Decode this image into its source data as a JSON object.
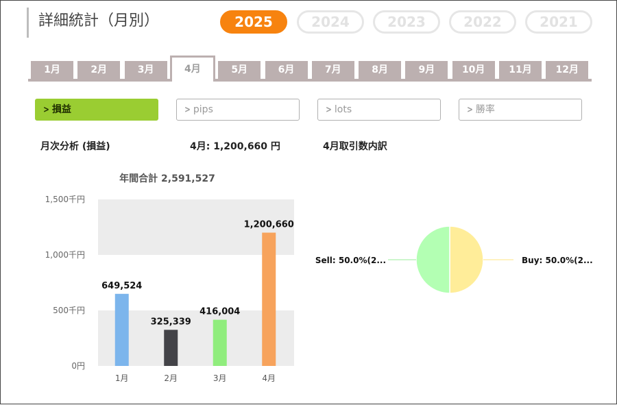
{
  "page_title": "詳細統計（月別）",
  "years": [
    {
      "label": "2025",
      "active": true
    },
    {
      "label": "2024",
      "active": false
    },
    {
      "label": "2023",
      "active": false
    },
    {
      "label": "2022",
      "active": false
    },
    {
      "label": "2021",
      "active": false
    }
  ],
  "months": [
    {
      "label": "1月",
      "active": false
    },
    {
      "label": "2月",
      "active": false
    },
    {
      "label": "3月",
      "active": false
    },
    {
      "label": "4月",
      "active": true
    },
    {
      "label": "5月",
      "active": false
    },
    {
      "label": "6月",
      "active": false
    },
    {
      "label": "7月",
      "active": false
    },
    {
      "label": "8月",
      "active": false
    },
    {
      "label": "9月",
      "active": false
    },
    {
      "label": "10月",
      "active": false
    },
    {
      "label": "11月",
      "active": false
    },
    {
      "label": "12月",
      "active": false
    }
  ],
  "metrics": [
    {
      "label": "損益",
      "active": true
    },
    {
      "label": "pips",
      "active": false
    },
    {
      "label": "lots",
      "active": false
    },
    {
      "label": "勝率",
      "active": false
    }
  ],
  "summary": {
    "monthly_analysis_label": "月次分析 (損益)",
    "selected_month_value": "4月:  1,200,660 円",
    "trade_breakdown_label": "4月取引数内訳"
  },
  "chart_data": [
    {
      "type": "bar",
      "title": "年間合計 2,591,527",
      "categories": [
        "1月",
        "2月",
        "3月",
        "4月"
      ],
      "values": [
        649524,
        325339,
        416004,
        1200660
      ],
      "value_labels": [
        "649,524",
        "325,339",
        "416,004",
        "1,200,660"
      ],
      "colors": [
        "#7cb5ec",
        "#434348",
        "#90ed7d",
        "#f7a35c"
      ],
      "y_ticks": [
        {
          "value": 0,
          "label": "0円"
        },
        {
          "value": 500000,
          "label": "500千円"
        },
        {
          "value": 1000000,
          "label": "1,000千円"
        },
        {
          "value": 1500000,
          "label": "1,500千円"
        }
      ],
      "ylim": [
        0,
        1500000
      ],
      "grid": "alternating bands"
    },
    {
      "type": "pie",
      "slices": [
        {
          "label": "Sell: 50.0%(2...",
          "value": 50.0,
          "color": "#b3ffb3"
        },
        {
          "label": "Buy: 50.0%(2...",
          "value": 50.0,
          "color": "#ffed99"
        }
      ]
    }
  ]
}
